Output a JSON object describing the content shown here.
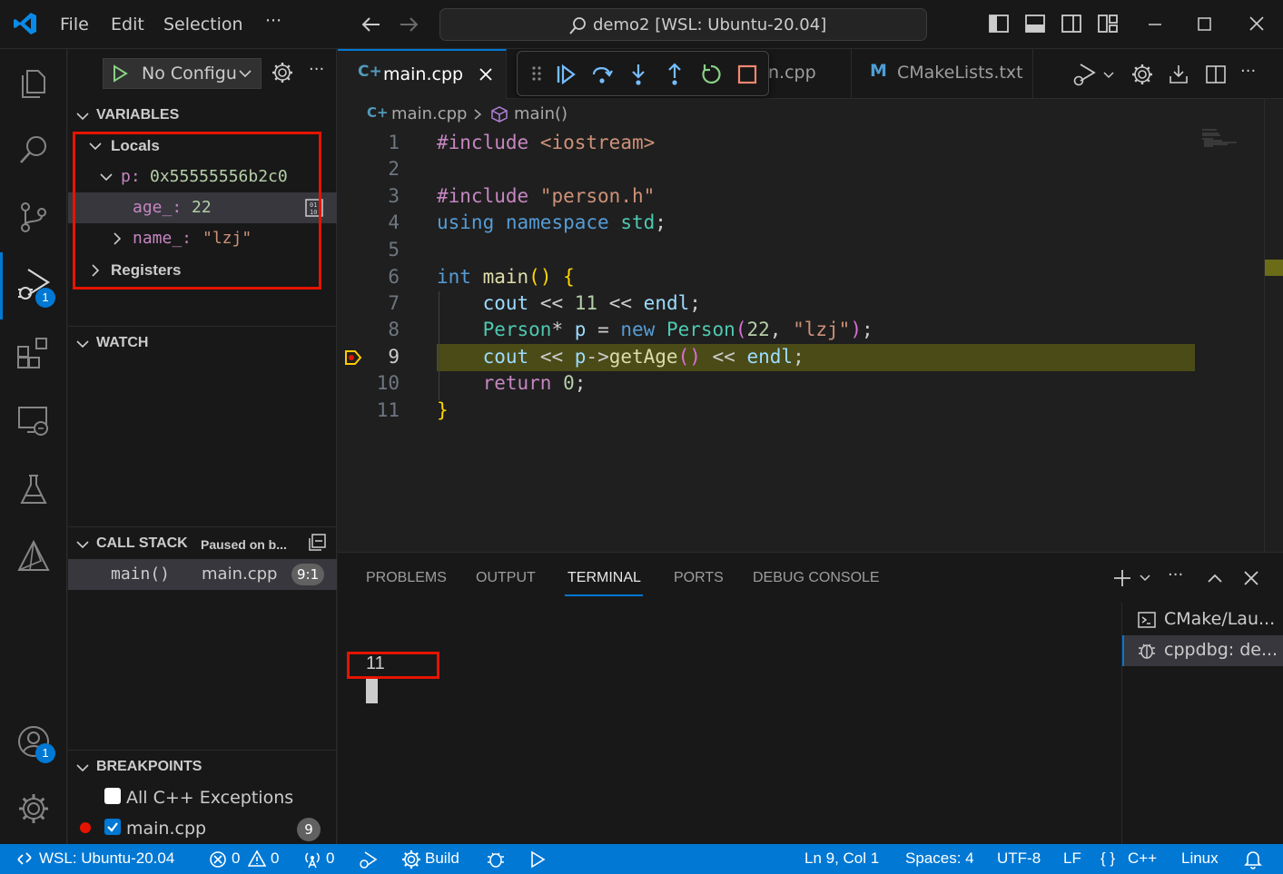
{
  "titlebar": {
    "menu": [
      "File",
      "Edit",
      "Selection",
      "···"
    ],
    "command_center": "demo2 [WSL: Ubuntu-20.04]"
  },
  "activitybar": {
    "run_debug_badge": "1",
    "accounts_badge": "1"
  },
  "sidebar": {
    "run_config": "No Configu",
    "variables_title": "VARIABLES",
    "locals_label": "Locals",
    "p_name": "p:",
    "p_value": "0x55555556b2c0",
    "age_name": "age_:",
    "age_value": "22",
    "name_name": "name_:",
    "name_value": "\"lzj\"",
    "registers_label": "Registers",
    "watch_title": "WATCH",
    "callstack_title": "CALL STACK",
    "callstack_status": "Paused on b...",
    "frame_fn": "main()",
    "frame_file": "main.cpp",
    "frame_pos": "9:1",
    "breakpoints_title": "BREAKPOINTS",
    "bp_all_cpp": "All C++ Exceptions",
    "bp_main": "main.cpp",
    "bp_main_line": "9"
  },
  "tabs": {
    "active": "main.cpp",
    "hidden_partial": "n.cpp",
    "cmake": "CMakeLists.txt"
  },
  "editor": {
    "breadcrumb_file": "main.cpp",
    "breadcrumb_symbol": "main()",
    "line_numbers": [
      "1",
      "2",
      "3",
      "4",
      "5",
      "6",
      "7",
      "8",
      "9",
      "10",
      "11"
    ],
    "current_line": 9,
    "code": {
      "l1_dir": "#include",
      "l1_str": "<iostream>",
      "l3_dir": "#include",
      "l3_str": "\"person.h\"",
      "l4_a": "using",
      "l4_b": "namespace",
      "l4_c": "std",
      "l4_d": ";",
      "l6_a": "int",
      "l6_b": "main",
      "l6_c": "()",
      "l6_d": "{",
      "l7_a": "cout",
      "l7_b": "<<",
      "l7_c": "11",
      "l7_d": "<<",
      "l7_e": "endl",
      "l7_f": ";",
      "l8_a": "Person",
      "l8_b": "*",
      "l8_c": "p",
      "l8_d": "=",
      "l8_e": "new",
      "l8_f": "Person",
      "l8_g": "(",
      "l8_h": "22",
      "l8_i": ",",
      "l8_j": "\"lzj\"",
      "l8_k": ")",
      "l8_l": ";",
      "l9_a": "cout",
      "l9_b": "<<",
      "l9_c": "p",
      "l9_d": "->",
      "l9_e": "getAge",
      "l9_f": "()",
      "l9_g": "<<",
      "l9_h": "endl",
      "l9_i": ";",
      "l10_a": "return",
      "l10_b": "0",
      "l10_c": ";",
      "l11_a": "}"
    }
  },
  "panel": {
    "tabs": [
      "PROBLEMS",
      "OUTPUT",
      "TERMINAL",
      "PORTS",
      "DEBUG CONSOLE"
    ],
    "active_tab": "TERMINAL",
    "terminal_output": "11",
    "terminals": [
      "CMake/Lau...",
      "cppdbg: de..."
    ]
  },
  "statusbar": {
    "remote": "WSL: Ubuntu-20.04",
    "errors": "0",
    "warnings": "0",
    "ports": "0",
    "build": "Build",
    "position": "Ln 9, Col 1",
    "spaces": "Spaces: 4",
    "encoding": "UTF-8",
    "eol": "LF",
    "language": "C++",
    "platform": "Linux"
  },
  "colors": {
    "accent": "#0078d4",
    "highlight_line": "#4b4b18",
    "annotation_box": "#e51400",
    "debug_blue": "#75beff",
    "debug_green": "#89d185"
  }
}
